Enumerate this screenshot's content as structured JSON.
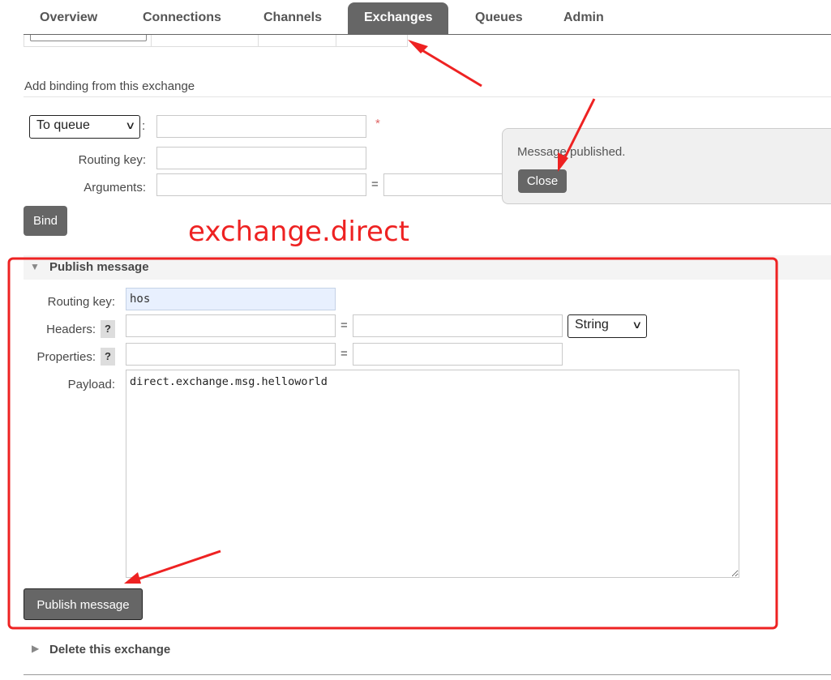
{
  "nav": {
    "tabs": [
      {
        "label": "Overview"
      },
      {
        "label": "Connections"
      },
      {
        "label": "Channels"
      },
      {
        "label": "Exchanges"
      },
      {
        "label": "Queues"
      },
      {
        "label": "Admin"
      }
    ],
    "active_tab": "Exchanges"
  },
  "binding": {
    "title": "Add binding from this exchange",
    "destination_select": "To queue",
    "colon": ":",
    "required_mark": "*",
    "routing_key_label": "Routing key:",
    "arguments_label": "Arguments:",
    "equals": "=",
    "bind_label": "Bind"
  },
  "notification": {
    "message": "Message published.",
    "close_label": "Close"
  },
  "annotation": {
    "text": "exchange.direct",
    "color": "#ee2222"
  },
  "publish": {
    "title": "Publish message",
    "routing_key_label": "Routing key:",
    "routing_key_value": "hos",
    "headers_label": "Headers:",
    "properties_label": "Properties:",
    "help_mark": "?",
    "equals": "=",
    "header_type_select": "String",
    "payload_label": "Payload:",
    "payload_value": "direct.exchange.msg.helloworld",
    "publish_button_label": "Publish message"
  },
  "delete": {
    "title": "Delete this exchange"
  },
  "colors": {
    "accent": "#666666",
    "input_filled": "#e8f0fe",
    "required": "#e06666"
  }
}
